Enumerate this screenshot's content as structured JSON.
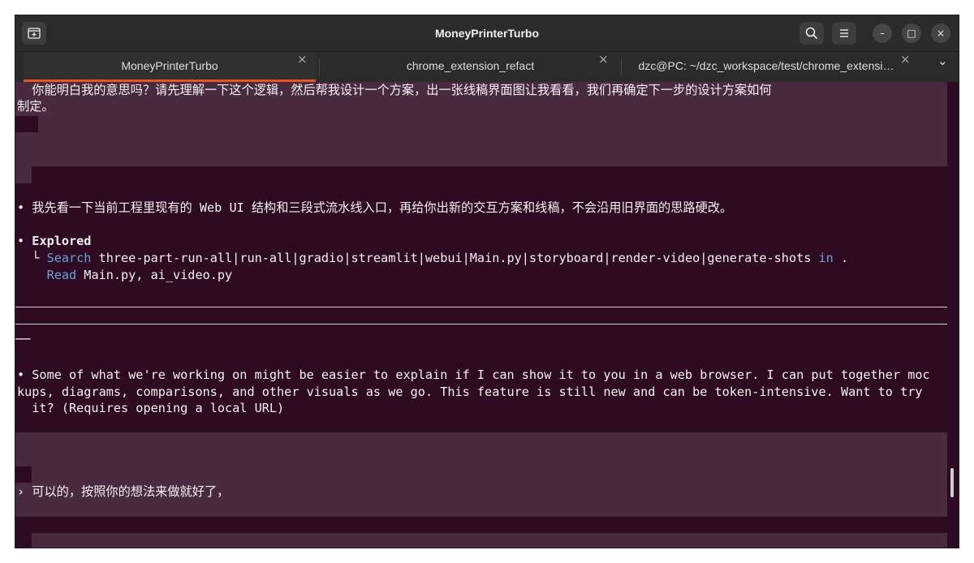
{
  "window": {
    "title": "MoneyPrinterTurbo",
    "new_tab_icon": "new-tab-icon",
    "search_icon": "search-icon",
    "menu_icon": "hamburger-menu-icon",
    "minimize_glyph": "–",
    "maximize_glyph": "□",
    "close_glyph": "×"
  },
  "tabs": [
    {
      "label": "MoneyPrinterTurbo",
      "active": true
    },
    {
      "label": "chrome_extension_refact",
      "active": false
    },
    {
      "label": "dzc@PC: ~/dzc_workspace/test/chrome_extensi…",
      "active": false
    }
  ],
  "tab_close_glyph": "×",
  "tab_overflow_glyph": "⌄",
  "terminal": {
    "user_msg_1_l1": "  你能明白我的意思吗？请先理解一下这个逻辑，然后帮我设计一个方案，出一张线稿界面图让我看看，我们再确定下一步的设计方案如何",
    "user_msg_1_l2": "制定。",
    "assistant_msg_1": "• 我先看一下当前工程里现有的 Web UI 结构和三段式流水线入口，再给你出新的交互方案和线稿，不会沿用旧界面的思路硬改。",
    "explored_bullet": "• ",
    "explored_label": "Explored",
    "search_prefix": "  └ ",
    "search_keyword": "Search",
    "search_args": " three-part-run-all|run-all|gradio|streamlit|webui|Main.py|storyboard|render-video|generate-shots ",
    "search_in": "in",
    "search_dot": " .",
    "read_prefix": "    ",
    "read_keyword": "Read",
    "read_args": " Main.py, ai_video.py",
    "dash_fragment": "──",
    "assistant_msg_2_l1": "• Some of what we're working on might be easier to explain if I can show it to you in a web browser. I can put together moc",
    "assistant_msg_2_l2": "kups, diagrams, comparisons, and other visuals as we go. This feature is still new and can be token-intensive. Want to try",
    "assistant_msg_2_l3": "  it? (Requires opening a local URL)",
    "user_msg_2": "› 可以的，按照你的想法来做就好了，"
  },
  "colors": {
    "terminal_bg": "#2f0a23",
    "user_block_bg": "#4a2a40",
    "keyword": "#6aa0dc",
    "active_tab_accent": "#e95420"
  }
}
